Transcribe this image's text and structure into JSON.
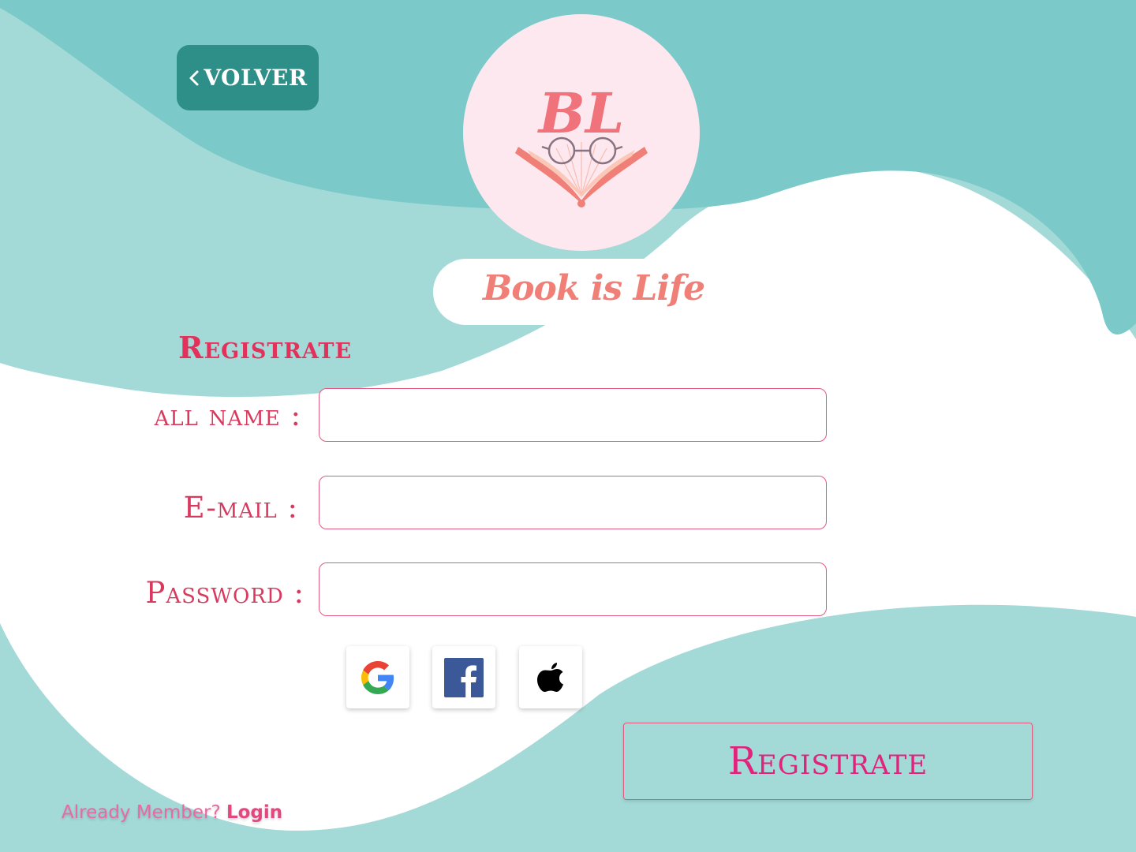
{
  "nav": {
    "back_label": "VOLVER"
  },
  "brand": {
    "monogram": "BL",
    "name": "Book is Life"
  },
  "form": {
    "title": "Registrate",
    "fields": [
      {
        "label": "all name :",
        "value": "",
        "placeholder": ""
      },
      {
        "label": "E-mail :",
        "value": "",
        "placeholder": ""
      },
      {
        "label": "Password :",
        "value": "",
        "placeholder": ""
      }
    ],
    "social": [
      {
        "icon": "google-icon"
      },
      {
        "icon": "facebook-icon"
      },
      {
        "icon": "apple-icon"
      }
    ],
    "submit_label": "Registrate"
  },
  "footer": {
    "prompt": "Already Member?",
    "login_label": "Login"
  },
  "colors": {
    "teal_dark": "#7bc9c9",
    "teal_light": "#a3dad8",
    "button_teal": "#2e8f88",
    "accent_pink": "#e2325c",
    "logo_bg": "#fde8ef",
    "brand_coral": "#f08077"
  }
}
